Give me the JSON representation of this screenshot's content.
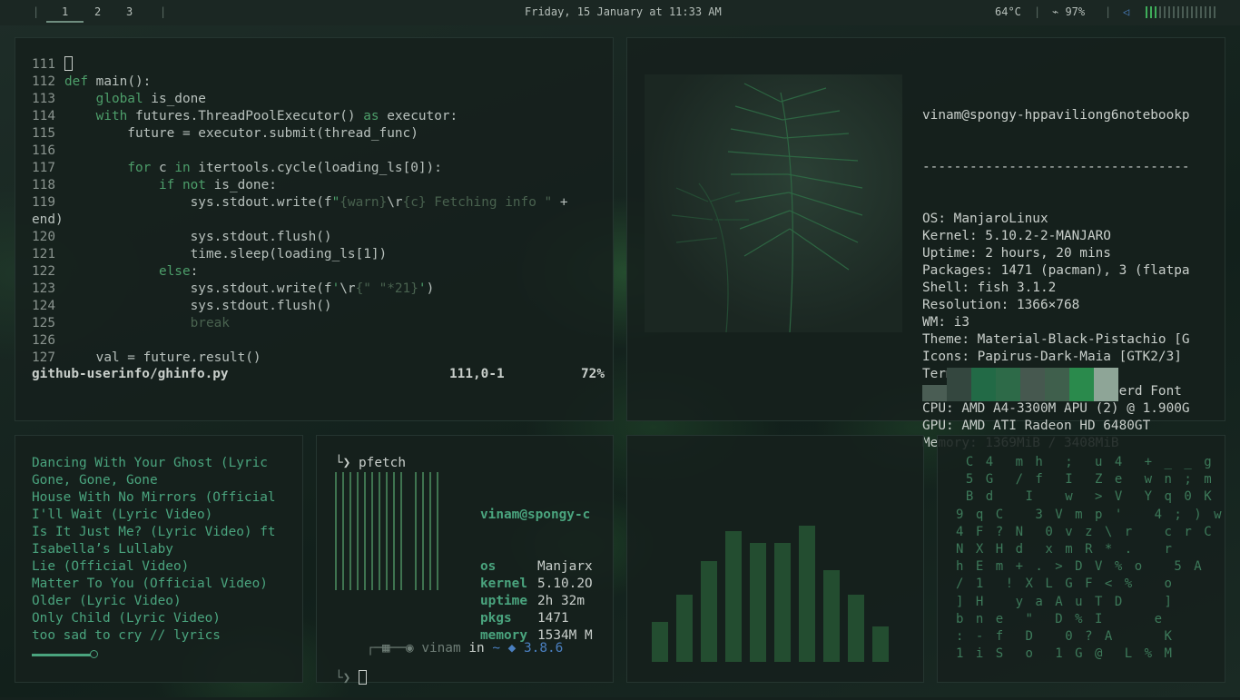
{
  "topbar": {
    "workspaces": [
      "1",
      "2",
      "3"
    ],
    "clock": "Friday, 15 January at 11:33 AM",
    "temperature": "64°C",
    "battery": "97%",
    "volume_bars_total": 16,
    "volume_bars_on": 3
  },
  "editor": {
    "lines": [
      {
        "n": "111",
        "html": "<span class=\"cursor\"></span>"
      },
      {
        "n": "112",
        "html": "<span class=\"kw\">def</span> main():"
      },
      {
        "n": "113",
        "html": "    <span class=\"kw\">global</span> is_done"
      },
      {
        "n": "114",
        "html": "    <span class=\"kw\">with</span> futures.ThreadPoolExecutor() <span class=\"kw\">as</span> executor:"
      },
      {
        "n": "115",
        "html": "        future = executor.submit(thread_func)"
      },
      {
        "n": "116",
        "html": ""
      },
      {
        "n": "117",
        "html": "        <span class=\"kw\">for</span> c <span class=\"kw\">in</span> itertools.cycle(loading_ls[0]):"
      },
      {
        "n": "118",
        "html": "            <span class=\"kw\">if not</span> is_done:"
      },
      {
        "n": "119",
        "html": "                sys.stdout.write(f<span class=\"str\">\"</span><span class=\"dim\">{warn}</span>\\r<span class=\"dim\">{c}</span><span class=\"dim\"> Fetching info \"</span> +"
      },
      {
        "n": "",
        "html": "end)"
      },
      {
        "n": "120",
        "html": "                sys.stdout.flush()"
      },
      {
        "n": "121",
        "html": "                time.sleep(loading_ls[1])"
      },
      {
        "n": "122",
        "html": "            <span class=\"kw\">else</span>:"
      },
      {
        "n": "123",
        "html": "                sys.stdout.write(f<span class=\"str\">'</span>\\r<span class=\"dim\">{\" \"*21}</span><span class=\"str\">'</span>)"
      },
      {
        "n": "124",
        "html": "                sys.stdout.flush()"
      },
      {
        "n": "125",
        "html": "                <span class=\"dim\">break</span>"
      },
      {
        "n": "126",
        "html": ""
      },
      {
        "n": "127",
        "html": "    val = future.result()"
      }
    ],
    "filename": "github-userinfo/ghinfo.py",
    "position": "111,0-1",
    "percent": "72%"
  },
  "fetch": {
    "header": "vinam@spongy-hppaviliong6notebookp",
    "divider": "----------------------------------",
    "rows": [
      "OS: ManjaroLinux",
      "Kernel: 5.10.2-2-MANJARO",
      "Uptime: 2 hours, 20 mins",
      "Packages: 1471 (pacman), 3 (flatpa",
      "Shell: fish 3.1.2",
      "Resolution: 1366×768",
      "WM: i3",
      "Theme: Material-Black-Pistachio [G",
      "Icons: Papirus-Dark-Maia [GTK2/3]",
      "Terminal: kitty",
      "Terminal Font: FiraCode Nerd Font",
      "CPU: AMD A4-3300M APU (2) @ 1.900G",
      "GPU: AMD ATI Radeon HD 6480GT",
      "Memory: 1369MiB / 3408MiB"
    ],
    "swatch_colors": [
      "#4a5d54",
      "#34473f",
      "#226a46",
      "#2d6a48",
      "#46584f",
      "#3f5f4c",
      "#2a8a4c",
      "#8ea597"
    ]
  },
  "music": {
    "songs": [
      "Dancing With Your Ghost (Lyric",
      "Gone, Gone, Gone",
      "House With No Mirrors (Official",
      "I'll Wait (Lyric Video)",
      "Is It Just Me? (Lyric Video) ft",
      "Isabella’s Lullaby",
      "Lie (Official Video)",
      "Matter To You (Official Video)",
      "Older (Lyric Video)",
      "Only Child (Lyric Video)",
      "too sad to cry // lyrics"
    ]
  },
  "pfetch": {
    "title": "pfetch",
    "user": "vinam@spongy-c",
    "rows": [
      {
        "k": "os",
        "v": "Manjarx"
      },
      {
        "k": "kernel",
        "v": "5.10.2O"
      },
      {
        "k": "uptime",
        "v": "2h 32m"
      },
      {
        "k": "pkgs",
        "v": "1471"
      },
      {
        "k": "memory",
        "v": "1534M M"
      }
    ],
    "prompt_user": "vinam",
    "prompt_in": "in",
    "prompt_dir": "~",
    "python_version": "3.8.6"
  },
  "visualizer": {
    "levels": [
      0.26,
      0.44,
      0.66,
      0.86,
      0.78,
      0.78,
      0.89,
      0.6,
      0.44,
      0.23
    ]
  },
  "matrix": {
    "rows": [
      " C 4  m h  ;  u 4  + _ _ g",
      " 5 G  / f  I  Z e  w n ; m",
      " B d   I   w  > V  Y q 0 K",
      "9 q C   3 V m p '   4 ; ) w",
      "4 F ? N  0 v z \\ r   c r C",
      "N X H d  x m R * .   r",
      "h E m + . > D V % o   5 A",
      "/ 1  ! X L G F < %   o",
      "] H   y a A u T D    ]",
      "b n e  \"  D % I     e",
      ": - f  D   0 ? A     K",
      "1 i S  o  1 G @  L % M"
    ]
  }
}
